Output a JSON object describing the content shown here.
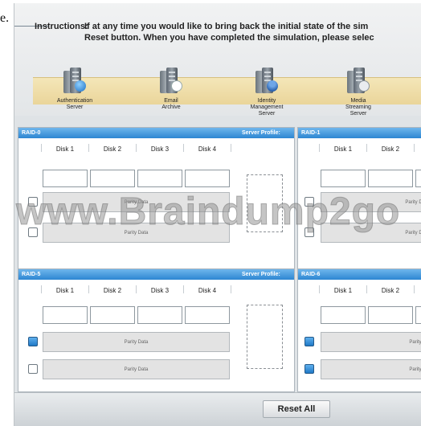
{
  "page_letter": "e.",
  "instructions": {
    "label": "Instructions:",
    "line1": "If at any time you would like to bring back the initial state of the sim",
    "line2": "Reset button. When you have completed the simulation, please selec"
  },
  "servers": [
    {
      "name": "Authentication\nServer",
      "icon": "globe-server-icon"
    },
    {
      "name": "Email\nArchive",
      "icon": "mail-server-icon"
    },
    {
      "name": "Identity\nManagement\nServer",
      "icon": "identity-server-icon"
    },
    {
      "name": "Media\nStreaming\nServer",
      "icon": "media-server-icon"
    }
  ],
  "panels": {
    "raid0": {
      "title": "RAID-0",
      "profile_label": "Server Profile:",
      "disks": [
        "Disk 1",
        "Disk 2",
        "Disk 3",
        "Disk 4"
      ],
      "parity_rows": [
        {
          "label": "Parity Data",
          "checked": false
        },
        {
          "label": "Parity Data",
          "checked": false
        }
      ]
    },
    "raid1": {
      "title": "RAID-1",
      "disks": [
        "Disk 1",
        "Disk 2"
      ],
      "parity_rows": [
        {
          "label": "Parity Data",
          "checked": false
        },
        {
          "label": "Parity Data",
          "checked": false
        }
      ]
    },
    "raid5": {
      "title": "RAID-5",
      "profile_label": "Server Profile:",
      "disks": [
        "Disk 1",
        "Disk 2",
        "Disk 3",
        "Disk 4"
      ],
      "parity_rows": [
        {
          "label": "Parity Data",
          "checked": true
        },
        {
          "label": "Parity Data",
          "checked": false
        }
      ]
    },
    "raid6": {
      "title": "RAID-6",
      "disks": [
        "Disk 1",
        "Disk 2"
      ],
      "parity_rows": [
        {
          "label": "Parity Da",
          "checked": true
        },
        {
          "label": "Parity Da",
          "checked": true
        }
      ]
    }
  },
  "watermark": "www.Braindump2go",
  "reset_button": "Reset All",
  "colors": {
    "panel_header": "#2d86d2",
    "checked": "#1f79c6",
    "server_band": "#ead59a"
  }
}
